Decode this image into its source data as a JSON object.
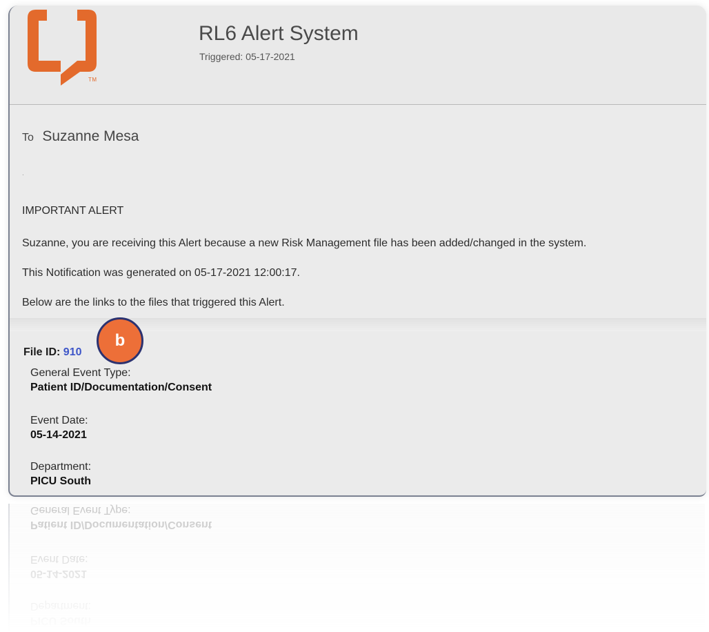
{
  "header": {
    "title": "RL6 Alert System",
    "triggered": "Triggered: 05-17-2021",
    "logo_tm": "TM",
    "logo_color": "#e36a2c"
  },
  "recipient": {
    "to_label": "To",
    "name": "Suzanne Mesa",
    "separator": "."
  },
  "message": {
    "heading": "IMPORTANT ALERT",
    "line1": "Suzanne, you are receiving this Alert because a new Risk Management file has been added/changed in the system.",
    "line2": "This Notification was generated on 05-17-2021 12:00:17.",
    "line3": "Below are the links to the files that triggered this Alert."
  },
  "file": {
    "id_label": "File ID:",
    "id_value": "910",
    "badge": "b",
    "general_event_type_label": "General Event Type:",
    "general_event_type_value": "Patient ID/Documentation/Consent",
    "event_date_label": "Event Date:",
    "event_date_value": "05-14-2021",
    "department_label": "Department:",
    "department_value": "PICU South"
  },
  "colors": {
    "badge_fill": "#ed6f38",
    "badge_border": "#2c3270",
    "link": "#3d55c8"
  }
}
